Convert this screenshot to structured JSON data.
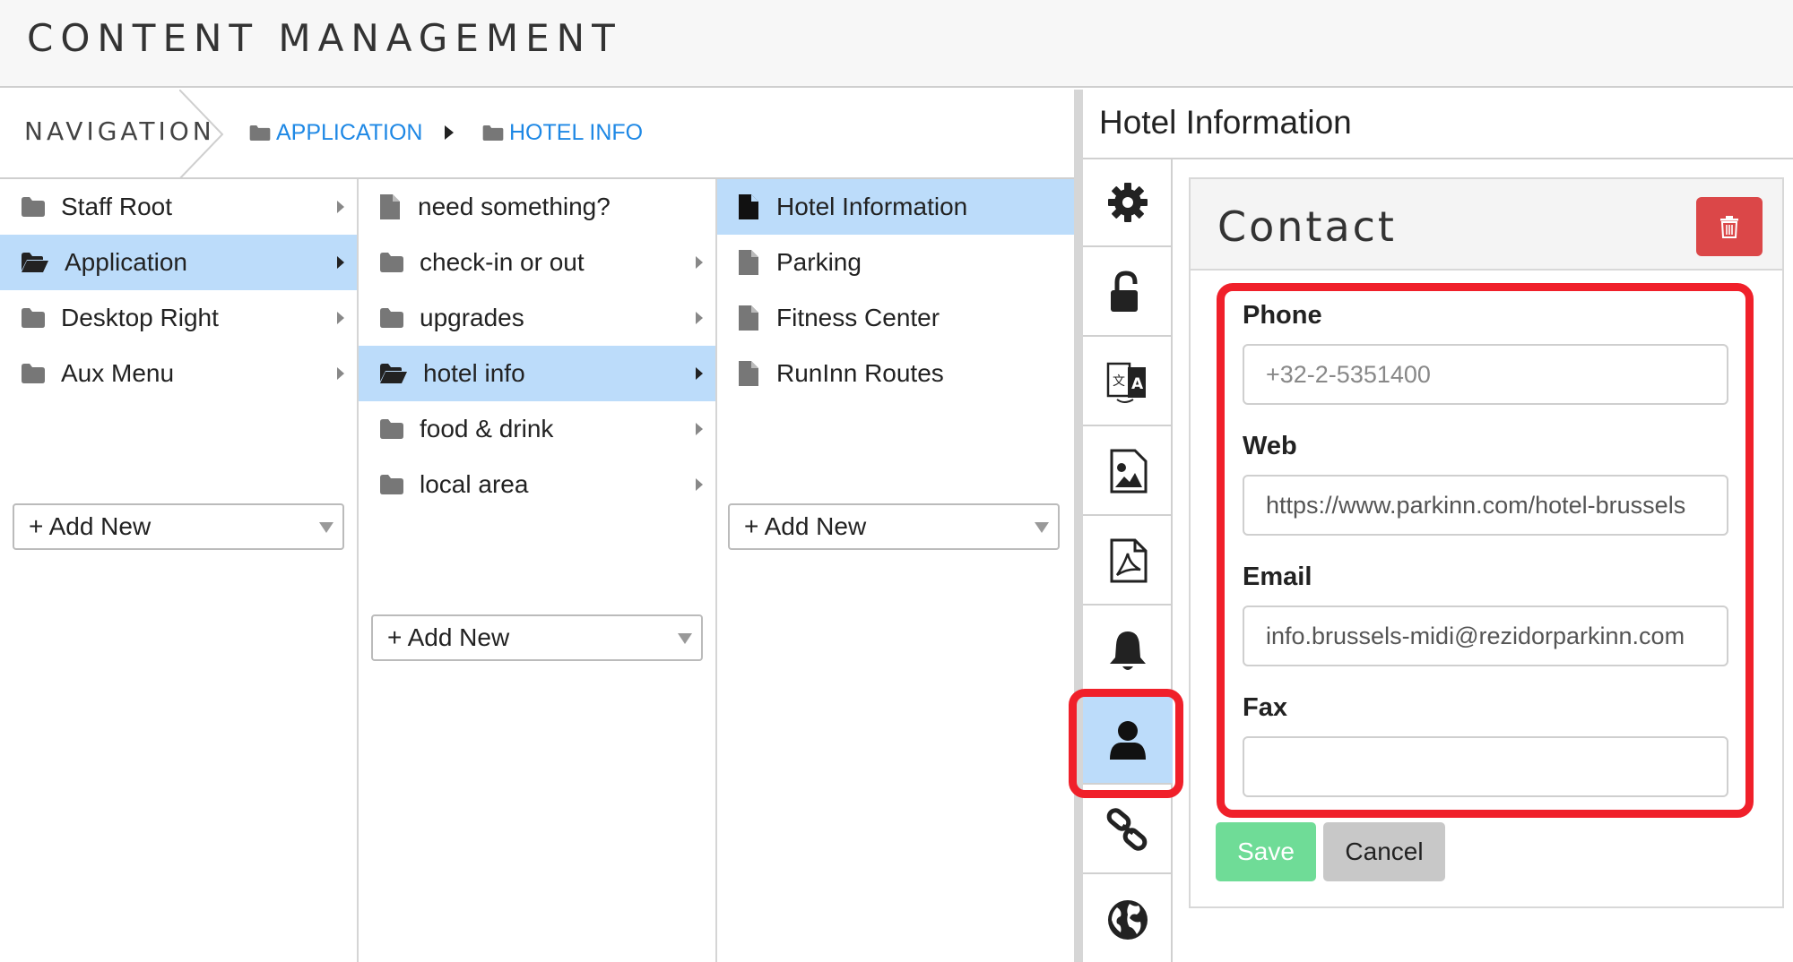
{
  "header": {
    "title": "CONTENT MANAGEMENT"
  },
  "breadcrumb": {
    "label": "NAVIGATION",
    "items": [
      "APPLICATION",
      "HOTEL INFO"
    ]
  },
  "columns": {
    "col1": {
      "items": [
        {
          "label": "Staff Root",
          "selected": false
        },
        {
          "label": "Application",
          "selected": true
        },
        {
          "label": "Desktop Right",
          "selected": false
        },
        {
          "label": "Aux Menu",
          "selected": false
        }
      ],
      "add_new": "+ Add New"
    },
    "col2": {
      "items": [
        {
          "label": "need something?",
          "type": "page"
        },
        {
          "label": "check-in or out",
          "type": "folder"
        },
        {
          "label": "upgrades",
          "type": "folder"
        },
        {
          "label": "hotel info",
          "type": "folder",
          "selected": true
        },
        {
          "label": "food & drink",
          "type": "folder"
        },
        {
          "label": "local area",
          "type": "folder"
        }
      ],
      "add_new": "+ Add New"
    },
    "col3": {
      "items": [
        {
          "label": "Hotel Information",
          "selected": true
        },
        {
          "label": "Parking"
        },
        {
          "label": "Fitness Center"
        },
        {
          "label": "RunInn Routes"
        }
      ],
      "add_new": "+ Add New"
    }
  },
  "panel": {
    "title": "Hotel Information",
    "tabs": [
      "settings-icon",
      "unlock-icon",
      "translate-icon",
      "image-icon",
      "pdf-icon",
      "bell-icon",
      "user-icon",
      "link-icon",
      "globe-icon"
    ],
    "active_tab": "user-icon"
  },
  "contact": {
    "title": "Contact",
    "fields": {
      "phone": {
        "label": "Phone",
        "placeholder": "+32-2-5351400"
      },
      "web": {
        "label": "Web",
        "value": "https://www.parkinn.com/hotel-brussels"
      },
      "email": {
        "label": "Email",
        "value": "info.brussels-midi@rezidorparkinn.com"
      },
      "fax": {
        "label": "Fax",
        "value": ""
      }
    },
    "save_label": "Save",
    "cancel_label": "Cancel"
  },
  "colors": {
    "accent": "#1e88e5",
    "selected_bg": "#bcdcfa",
    "delete": "#db4748",
    "save": "#6fdc97",
    "highlight": "#f0202a"
  }
}
